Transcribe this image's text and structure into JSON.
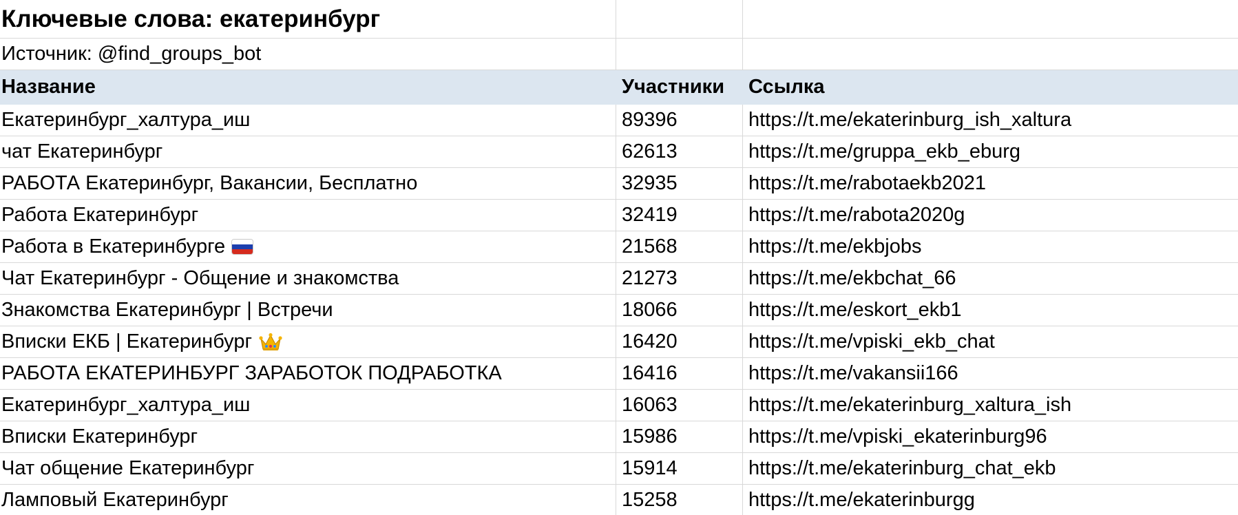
{
  "title": "Ключевые слова: екатеринбург",
  "source": "Источник: @find_groups_bot",
  "columns": {
    "name": "Название",
    "members": "Участники",
    "link": "Ссылка"
  },
  "rows": [
    {
      "name": "Екатеринбург_халтура_иш",
      "members": "89396",
      "link": "https://t.me/ekaterinburg_ish_xaltura",
      "emoji": ""
    },
    {
      "name": "чат Екатеринбург",
      "members": "62613",
      "link": "https://t.me/gruppa_ekb_eburg",
      "emoji": ""
    },
    {
      "name": "РАБОТА Екатеринбург, Вакансии, Бесплатно",
      "members": "32935",
      "link": "https://t.me/rabotaekb2021",
      "emoji": ""
    },
    {
      "name": "Работа Екатеринбург",
      "members": "32419",
      "link": "https://t.me/rabota2020g",
      "emoji": ""
    },
    {
      "name": "Работа в Екатеринбурге",
      "members": "21568",
      "link": "https://t.me/ekbjobs",
      "emoji": "russia-flag-icon"
    },
    {
      "name": "Чат Екатеринбург - Общение и знакомства",
      "members": "21273",
      "link": "https://t.me/ekbchat_66",
      "emoji": ""
    },
    {
      "name": "Знакомства Екатеринбург | Встречи",
      "members": "18066",
      "link": "https://t.me/eskort_ekb1",
      "emoji": ""
    },
    {
      "name": "Вписки ЕКБ | Екатеринбург",
      "members": "16420",
      "link": "https://t.me/vpiski_ekb_chat",
      "emoji": "crown-icon"
    },
    {
      "name": "РАБОТА ЕКАТЕРИНБУРГ ЗАРАБОТОК ПОДРАБОТКА",
      "members": "16416",
      "link": "https://t.me/vakansii166",
      "emoji": ""
    },
    {
      "name": "Екатеринбург_халтура_иш",
      "members": "16063",
      "link": "https://t.me/ekaterinburg_xaltura_ish",
      "emoji": ""
    },
    {
      "name": "Вписки Екатеринбург",
      "members": "15986",
      "link": "https://t.me/vpiski_ekaterinburg96",
      "emoji": ""
    },
    {
      "name": "Чат общение Екатеринбург",
      "members": "15914",
      "link": "https://t.me/ekaterinburg_chat_ekb",
      "emoji": ""
    },
    {
      "name": "Ламповый Екатеринбург",
      "members": "15258",
      "link": "https://t.me/ekaterinburgg",
      "emoji": ""
    }
  ],
  "colors": {
    "header_bg": "#dce6f0",
    "grid": "#d8d8d8"
  }
}
